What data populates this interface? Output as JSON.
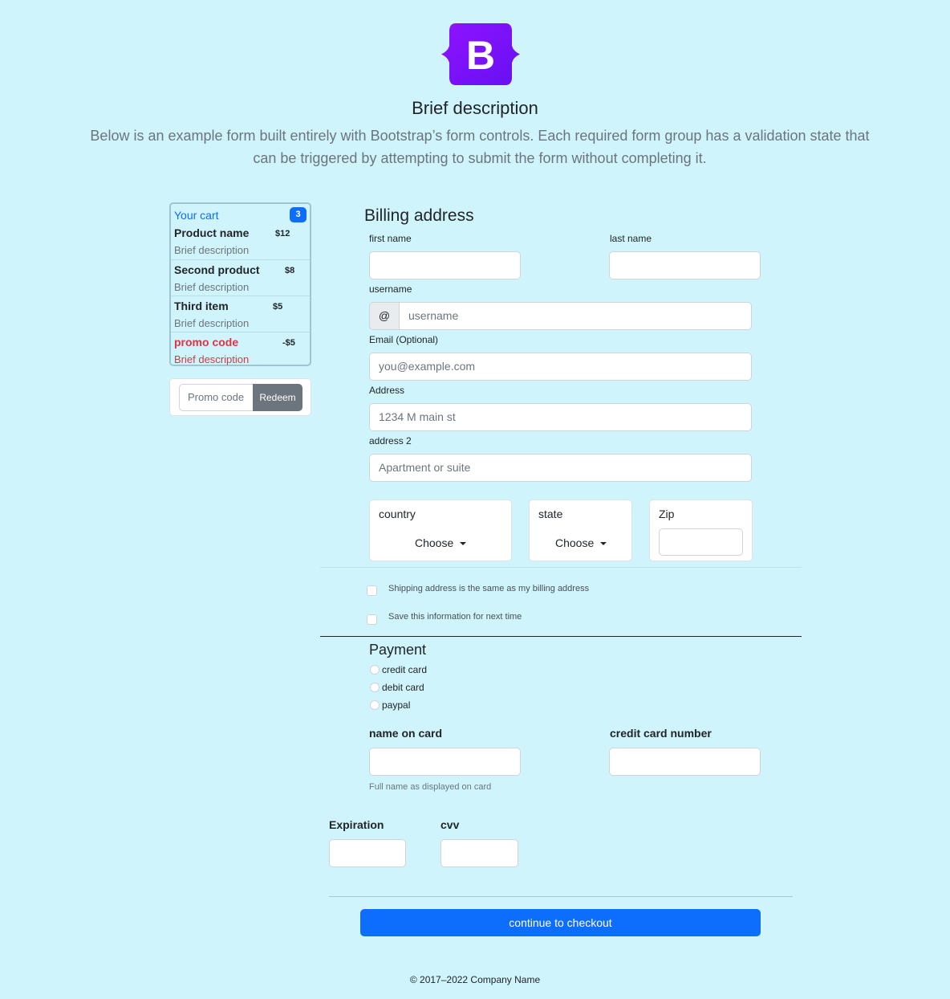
{
  "header": {
    "logo_letter": "B",
    "title": "Brief description",
    "lead": "Below is an example form built entirely with Bootstrap’s form controls. Each required form group has a validation state that can be triggered by attempting to submit the form without completing it."
  },
  "cart": {
    "title": "Your cart",
    "count": "3",
    "items": [
      {
        "name": "Product name",
        "price": "$12",
        "desc": "Brief description"
      },
      {
        "name": "Second product",
        "price": "$8",
        "desc": "Brief description"
      },
      {
        "name": "Third item",
        "price": "$5",
        "desc": "Brief description"
      },
      {
        "name": "promo code",
        "price": "-$5",
        "desc": "Brief description"
      }
    ],
    "promo_placeholder": "Promo code",
    "redeem_label": "Redeem"
  },
  "billing": {
    "title": "Billing address",
    "first_name_label": "first name",
    "last_name_label": "last name",
    "username_label": "username",
    "username_prefix": "@",
    "username_placeholder": "username",
    "email_label": "Email (Optional)",
    "email_placeholder": "you@example.com",
    "address_label": "Address",
    "address_placeholder": "1234 M main st",
    "address2_label": "address 2",
    "address2_placeholder": "Apartment or suite",
    "country_label": "country",
    "country_value": "Choose",
    "state_label": "state",
    "state_value": "Choose",
    "zip_label": "Zip"
  },
  "options": {
    "same_address": "Shipping address is the same as my billing address",
    "save_info": "Save this information for next time"
  },
  "payment": {
    "title": "Payment",
    "methods": [
      "credit card",
      "debit card",
      "paypal"
    ],
    "name_on_card_label": "name on card",
    "name_on_card_help": "Full name as displayed on card",
    "card_number_label": "credit card number",
    "expiration_label": "Expiration",
    "cvv_label": "cvv"
  },
  "checkout_label": "continue to checkout",
  "footer": "© 2017–2022 Company Name",
  "colors": {
    "background": "#cff4fc",
    "primary": "#0d6efd",
    "logo_purple": "#7b1fe8",
    "danger": "#dc3545",
    "secondary": "#6c757d"
  }
}
